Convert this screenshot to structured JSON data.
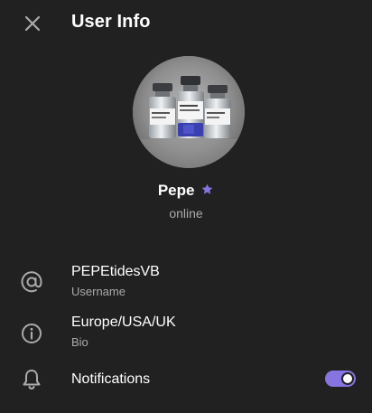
{
  "header": {
    "title": "User Info",
    "close_icon": "close-icon"
  },
  "profile": {
    "name": "Pepe",
    "badge_icon": "premium-star-icon",
    "status": "online"
  },
  "rows": [
    {
      "icon": "at-icon",
      "value": "PEPEtidesVB",
      "label": "Username"
    },
    {
      "icon": "info-icon",
      "value": "Europe/USA/UK",
      "label": "Bio"
    },
    {
      "icon": "bell-icon",
      "value": "Notifications",
      "toggle_on": true
    }
  ],
  "colors": {
    "background": "#212121",
    "accent": "#8774e1",
    "secondary_text": "#aaaaaa",
    "icon": "#aaaaaa"
  }
}
